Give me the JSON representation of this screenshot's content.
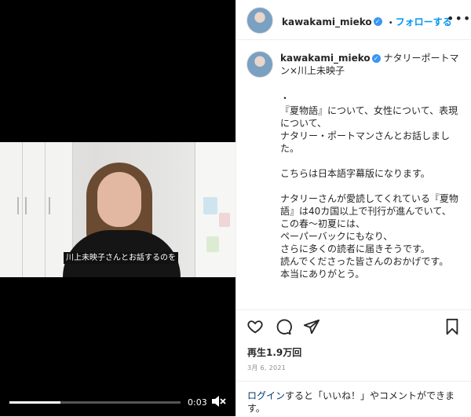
{
  "video": {
    "subtitle": "川上未映子さんとお話するのを",
    "time": "0:03",
    "progress": 0.3
  },
  "header": {
    "username": "kawakami_mieko",
    "separator": "•",
    "follow_label": "フォローする"
  },
  "caption": {
    "username": "kawakami_mieko",
    "title": "ナタリーポートマン×川上未映子",
    "body": "・\n『夏物語』について、女性について、表現について、\nナタリー・ポートマンさんとお話しました。\n\nこちらは日本語字幕版になります。\n\nナタリーさんが愛読してくれている『夏物語』は40カ国以上で刊行が進んでいて、\nこの春〜初夏には、\nペーパーバックにもなり、\nさらに多くの読者に届きそうです。\n読んでくださった皆さんのおかげです。\n本当にありがとう。"
  },
  "stats": {
    "views": "再生1.9万回",
    "date": "3月 6, 2021"
  },
  "login": {
    "link": "ログイン",
    "text": "すると「いいね！」やコメントができます。"
  },
  "colors": {
    "accent": "#0095f6",
    "verified": "#3897f0"
  },
  "icons": [
    "heart-icon",
    "comment-icon",
    "share-icon",
    "bookmark-icon",
    "more-icon",
    "mute-icon",
    "verified-icon"
  ]
}
